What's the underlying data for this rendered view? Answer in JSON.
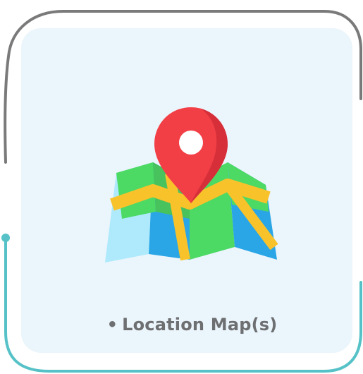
{
  "card": {
    "bullet": "•",
    "label": "Location Map(s)",
    "icon": "folded-map-with-location-pin-icon"
  },
  "colors": {
    "card_background": "#ebf5fc",
    "frame_gray": "#7a7a7a",
    "frame_teal": "#56c2c7",
    "label_text": "#6d6f71",
    "pin_red": "#f23f46",
    "map_green": "#4cd964",
    "map_blue": "#2aa6e6",
    "map_yellow": "#f8c22b"
  }
}
